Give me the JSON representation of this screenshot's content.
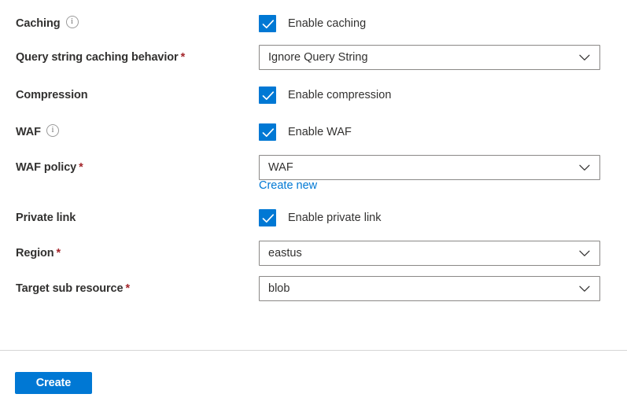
{
  "colors": {
    "accent": "#0078d4",
    "required_asterisk": "#a4262c",
    "link": "#0078d4",
    "label_text": "#323130",
    "field_border": "#8a8886",
    "divider": "#d6d6d6"
  },
  "form": {
    "rows": [
      {
        "id": "caching",
        "label": "Caching",
        "required": false,
        "info_icon": "info-icon",
        "control": "checkbox",
        "checkbox_label": "Enable caching",
        "checked": true
      },
      {
        "id": "query-string-caching-behavior",
        "label": "Query string caching behavior",
        "required": true,
        "info_icon": null,
        "control": "dropdown",
        "value": "Ignore Query String",
        "chevron_icon": "chevron-down-icon"
      },
      {
        "id": "compression",
        "label": "Compression",
        "required": false,
        "info_icon": null,
        "control": "checkbox",
        "checkbox_label": "Enable compression",
        "checked": true
      },
      {
        "id": "waf",
        "label": "WAF",
        "required": false,
        "info_icon": "info-icon",
        "control": "checkbox",
        "checkbox_label": "Enable WAF",
        "checked": true
      },
      {
        "id": "waf-policy",
        "label": "WAF policy",
        "required": true,
        "info_icon": null,
        "control": "dropdown",
        "value": "WAF",
        "chevron_icon": "chevron-down-icon",
        "link_label": "Create new"
      },
      {
        "id": "private-link",
        "label": "Private link",
        "required": false,
        "info_icon": null,
        "control": "checkbox",
        "checkbox_label": "Enable private link",
        "checked": true
      },
      {
        "id": "region",
        "label": "Region",
        "required": true,
        "info_icon": null,
        "control": "dropdown",
        "value": "eastus",
        "chevron_icon": "chevron-down-icon"
      },
      {
        "id": "target-sub-resource",
        "label": "Target sub resource",
        "required": true,
        "info_icon": null,
        "control": "dropdown",
        "value": "blob",
        "chevron_icon": "chevron-down-icon"
      }
    ]
  },
  "footer": {
    "create_label": "Create"
  }
}
